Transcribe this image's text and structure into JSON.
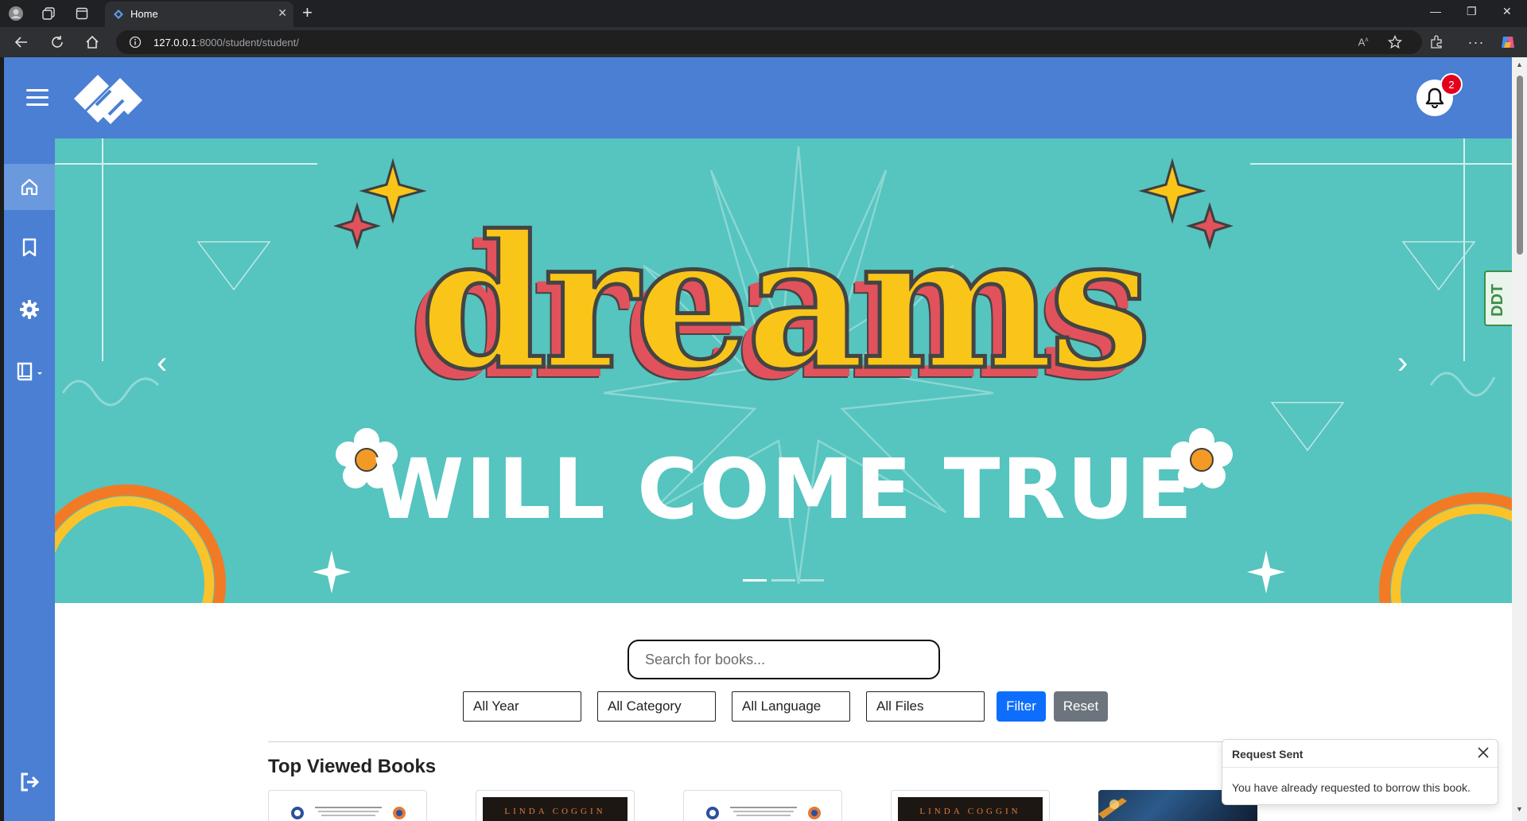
{
  "browser": {
    "tab_title": "Home",
    "url_host": "127.0.0.1",
    "url_path": ":8000/student/student/"
  },
  "header": {
    "notification_count": "2"
  },
  "carousel": {
    "headline": "dreams",
    "subline": "WILL COME TRUE",
    "slide_count": 3,
    "active_slide": 1
  },
  "search": {
    "placeholder": "Search for books..."
  },
  "filters": {
    "year": "All Year",
    "category": "All Category",
    "language": "All Language",
    "files": "All Files",
    "filter_label": "Filter",
    "reset_label": "Reset"
  },
  "section": {
    "title": "Top Viewed Books"
  },
  "books": [
    {
      "cover": "document"
    },
    {
      "cover": "dark",
      "author": "LINDA COGGIN"
    },
    {
      "cover": "document"
    },
    {
      "cover": "dark",
      "author": "LINDA COGGIN"
    },
    {
      "cover": "space"
    }
  ],
  "toast": {
    "title": "Request Sent",
    "message": "You have already requested to borrow this book."
  },
  "side_widget": {
    "label": "DDT"
  },
  "colors": {
    "brand_blue": "#4a7fd3",
    "banner_teal": "#56c4bf",
    "filter_button": "#0d6efd",
    "reset_button": "#6c757d",
    "badge_red": "#e4001b"
  }
}
